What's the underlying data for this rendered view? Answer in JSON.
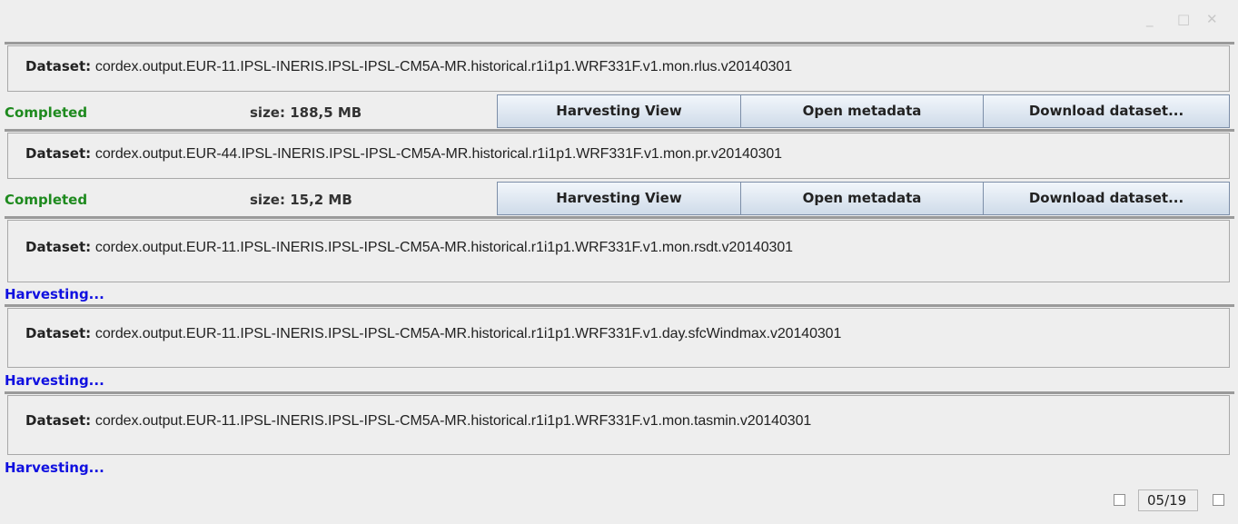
{
  "window": {
    "minimize_icon": "_",
    "maximize_icon": "□",
    "close_icon": "✕"
  },
  "items": [
    {
      "label": "Dataset:",
      "name": "cordex.output.EUR-11.IPSL-INERIS.IPSL-IPSL-CM5A-MR.historical.r1i1p1.WRF331F.v1.mon.rlus.v20140301",
      "status": "Completed",
      "size": "size: 188,5 MB",
      "buttons": [
        "Harvesting View",
        "Open metadata",
        "Download dataset..."
      ]
    },
    {
      "label": "Dataset:",
      "name": "cordex.output.EUR-44.IPSL-INERIS.IPSL-IPSL-CM5A-MR.historical.r1i1p1.WRF331F.v1.mon.pr.v20140301",
      "status": "Completed",
      "size": "size: 15,2 MB",
      "buttons": [
        "Harvesting View",
        "Open metadata",
        "Download dataset..."
      ]
    },
    {
      "label": "Dataset:",
      "name": "cordex.output.EUR-11.IPSL-INERIS.IPSL-IPSL-CM5A-MR.historical.r1i1p1.WRF331F.v1.mon.rsdt.v20140301",
      "status": "Harvesting..."
    },
    {
      "label": "Dataset:",
      "name": "cordex.output.EUR-11.IPSL-INERIS.IPSL-IPSL-CM5A-MR.historical.r1i1p1.WRF331F.v1.day.sfcWindmax.v20140301",
      "status": "Harvesting..."
    },
    {
      "label": "Dataset:",
      "name": "cordex.output.EUR-11.IPSL-INERIS.IPSL-IPSL-CM5A-MR.historical.r1i1p1.WRF331F.v1.mon.tasmin.v20140301",
      "status": "Harvesting..."
    }
  ],
  "pager": {
    "page": "05/19"
  },
  "colors": {
    "completed": "#1e8a1e",
    "harvesting": "#1010e0",
    "background": "#eeeeee"
  }
}
